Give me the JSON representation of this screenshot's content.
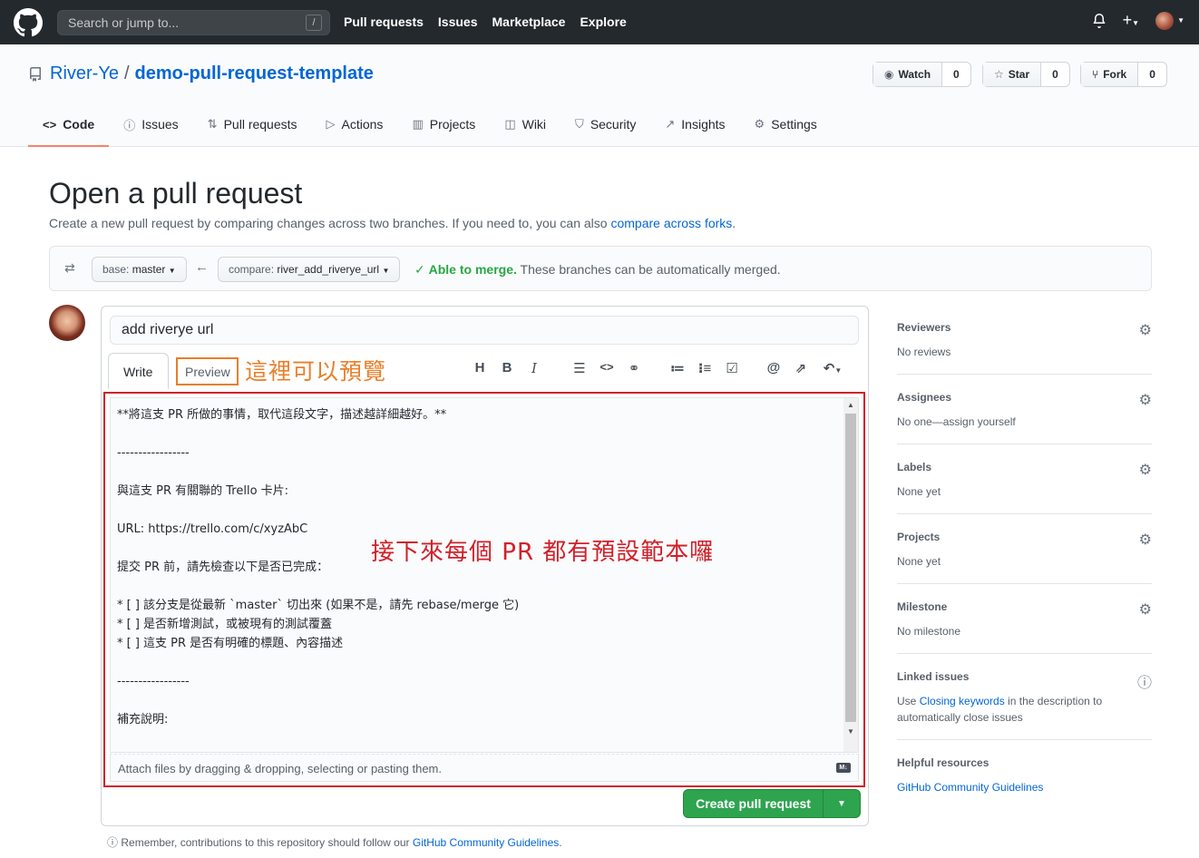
{
  "topbar": {
    "search_placeholder": "Search or jump to...",
    "slash": "/",
    "nav": [
      "Pull requests",
      "Issues",
      "Marketplace",
      "Explore"
    ]
  },
  "repo": {
    "owner": "River-Ye",
    "separator": "/",
    "name": "demo-pull-request-template",
    "watch": {
      "label": "Watch",
      "count": "0"
    },
    "star": {
      "label": "Star",
      "count": "0"
    },
    "fork": {
      "label": "Fork",
      "count": "0"
    }
  },
  "tabs": [
    {
      "label": "Code",
      "icon": "code-icon"
    },
    {
      "label": "Issues",
      "icon": "issue-icon"
    },
    {
      "label": "Pull requests",
      "icon": "pr-icon"
    },
    {
      "label": "Actions",
      "icon": "play-icon"
    },
    {
      "label": "Projects",
      "icon": "project-icon"
    },
    {
      "label": "Wiki",
      "icon": "book-icon"
    },
    {
      "label": "Security",
      "icon": "shield-icon"
    },
    {
      "label": "Insights",
      "icon": "graph-icon"
    },
    {
      "label": "Settings",
      "icon": "gear-icon"
    }
  ],
  "page": {
    "title": "Open a pull request",
    "subtitle": "Create a new pull request by comparing changes across two branches. If you need to, you can also",
    "subtitle_link": "compare across forks",
    "subtitle_end": "."
  },
  "range": {
    "base_prefix": "base:",
    "base": "master",
    "compare_prefix": "compare:",
    "compare": "river_add_riverye_url",
    "merge_ok": "Able to merge.",
    "merge_text": "These branches can be automatically merged."
  },
  "form": {
    "title_value": "add riverye url",
    "write_tab": "Write",
    "preview_tab": "Preview",
    "body": "**將這支 PR 所做的事情，取代這段文字，描述越詳細越好。**\n\n-----------------\n\n與這支 PR 有關聯的 Trello 卡片:\n\nURL: https://trello.com/c/xyzAbC\n\n提交 PR 前，請先檢查以下是否已完成：\n\n* [ ] 該分支是從最新 `master` 切出來 (如果不是，請先 rebase/merge 它)\n* [ ] 是否新增測試，或被現有的測試覆蓋\n* [ ] 這支 PR 是否有明確的標題、內容描述\n\n-----------------\n\n補充說明:",
    "attach": "Attach files by dragging & dropping, selecting or pasting them.",
    "md_badge": "M↓",
    "create_button": "Create pull request"
  },
  "annotations": {
    "preview_note": "這裡可以預覽",
    "template_note": "接下來每個 PR 都有預設範本囉"
  },
  "note": {
    "text": "Remember, contributions to this repository should follow our",
    "link": "GitHub Community Guidelines",
    "end": "."
  },
  "sidebar": [
    {
      "title": "Reviewers",
      "value": "No reviews"
    },
    {
      "title": "Assignees",
      "value": "No one—assign yourself"
    },
    {
      "title": "Labels",
      "value": "None yet"
    },
    {
      "title": "Projects",
      "value": "None yet"
    },
    {
      "title": "Milestone",
      "value": "No milestone"
    }
  ],
  "linked": {
    "title": "Linked issues",
    "pre": "Use",
    "link": "Closing keywords",
    "post": "in the description to automatically close issues"
  },
  "helpful": {
    "title": "Helpful resources",
    "link": "GitHub Community Guidelines"
  },
  "colors": {
    "accent": "#0366d6",
    "green": "#2ea44f",
    "annotation_red": "#d0202a",
    "annotation_orange": "#e87f2a"
  }
}
